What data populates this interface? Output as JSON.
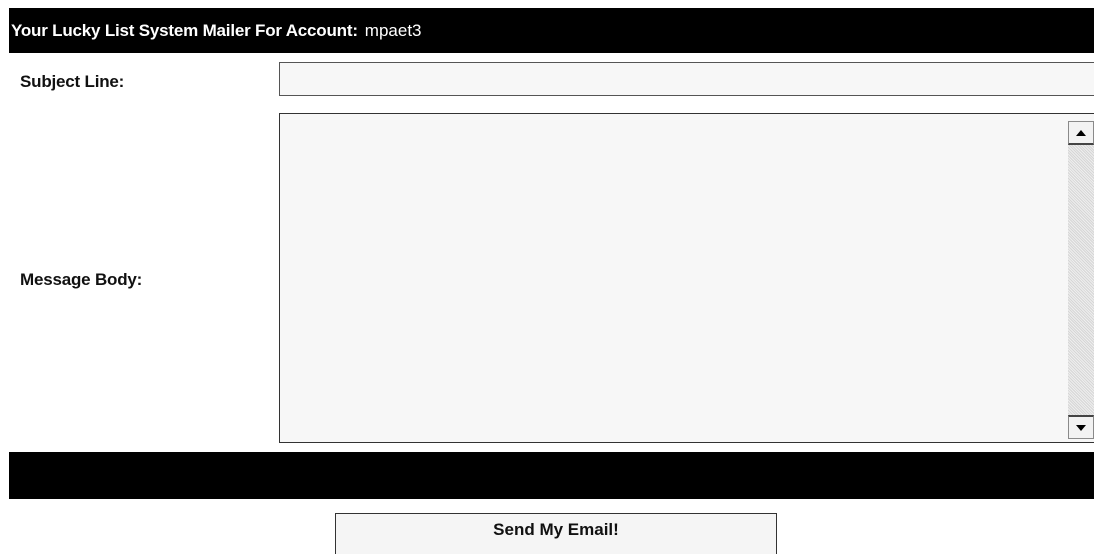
{
  "header": {
    "title": "Your Lucky List System Mailer For Account:",
    "account": "mpaet3",
    "background_color": "#000000",
    "text_color": "#ffffff"
  },
  "form": {
    "subject_label": "Subject Line:",
    "subject_value": "",
    "message_label": "Message Body:",
    "message_value": "",
    "submit_label": "Send My Email!"
  },
  "icons": {
    "scroll_up": "triangle-up-icon",
    "scroll_down": "triangle-down-icon"
  }
}
